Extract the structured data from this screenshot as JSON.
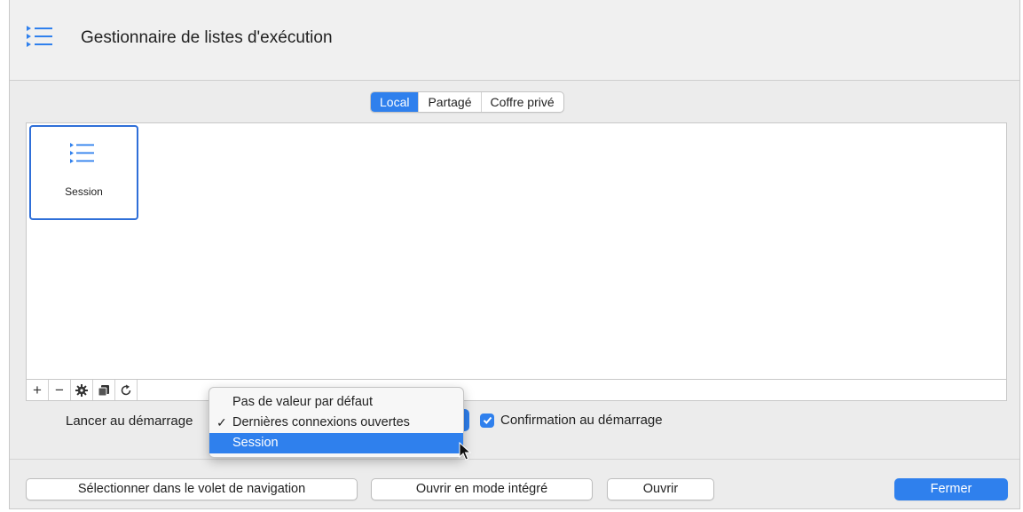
{
  "window": {
    "title": "Gestionnaire de listes d'exécution",
    "title_icon": "list-icon"
  },
  "tabs": [
    {
      "label": "Local",
      "active": true
    },
    {
      "label": "Partagé",
      "active": false
    },
    {
      "label": "Coffre privé",
      "active": false
    }
  ],
  "list": {
    "items": [
      {
        "label": "Session",
        "icon": "list-icon",
        "selected": true
      }
    ]
  },
  "toolbar": {
    "add_label": "+",
    "remove_label": "−",
    "settings_icon": "gear-icon",
    "duplicate_icon": "duplicate-icon",
    "refresh_icon": "refresh-icon"
  },
  "launch": {
    "label": "Lancer au démarrage",
    "options": [
      {
        "label": "Pas de valeur par défaut",
        "checked": false,
        "highlighted": false
      },
      {
        "label": "Dernières connexions ouvertes",
        "checked": true,
        "highlighted": false
      },
      {
        "label": "Session",
        "checked": false,
        "highlighted": true
      }
    ]
  },
  "confirmation": {
    "label": "Confirmation au démarrage",
    "checked": true
  },
  "footer": {
    "select_in_nav": "Sélectionner dans le volet de navigation",
    "open_embedded": "Ouvrir en mode intégré",
    "open": "Ouvrir",
    "close": "Fermer"
  },
  "colors": {
    "accent": "#2f80ed",
    "window_bg": "#ececec"
  }
}
